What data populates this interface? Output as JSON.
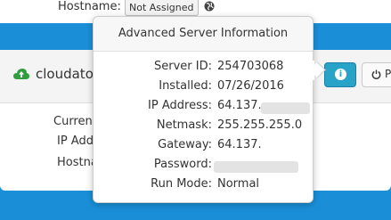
{
  "top": {
    "hostname_label": "Hostname:",
    "hostname_button": "Not Assigned"
  },
  "card": {
    "server_name": "cloudato",
    "rows": [
      "Curren",
      "IP Add",
      "Hostna"
    ],
    "power_label": "P"
  },
  "popover": {
    "title": "Advanced Server Information",
    "rows": [
      {
        "label": "Server ID:",
        "value": "254703068"
      },
      {
        "label": "Installed:",
        "value": "07/26/2016"
      },
      {
        "label": "IP Address:",
        "value": "64.137."
      },
      {
        "label": "Netmask:",
        "value": "255.255.255.0"
      },
      {
        "label": "Gateway:",
        "value": "64.137."
      },
      {
        "label": "Password:",
        "value": ""
      },
      {
        "label": "Run Mode:",
        "value": "Normal"
      }
    ]
  },
  "colors": {
    "page_background": "#1a8fd8",
    "info_button": "#2aa3c9",
    "cloud_icon": "#2e9e3e"
  }
}
